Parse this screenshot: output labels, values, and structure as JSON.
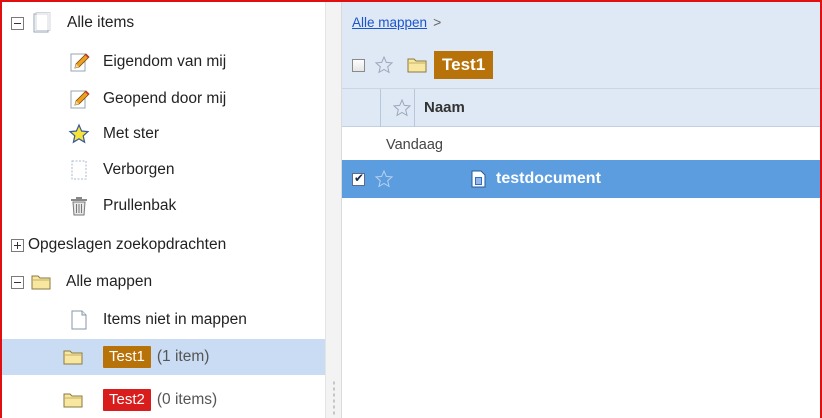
{
  "sidebar": {
    "all_items": {
      "label": "Alle items",
      "icon": "document-stack-icon"
    },
    "items": [
      {
        "label": "Eigendom van mij",
        "icon": "pencil-icon"
      },
      {
        "label": "Geopend door mij",
        "icon": "pencil-icon"
      },
      {
        "label": "Met ster",
        "icon": "star-icon"
      },
      {
        "label": "Verborgen",
        "icon": "hidden-document-icon"
      },
      {
        "label": "Prullenbak",
        "icon": "trash-icon"
      }
    ],
    "saved_searches": {
      "label": "Opgeslagen zoekopdrachten"
    },
    "all_folders": {
      "label": "Alle mappen",
      "icon": "folder-icon"
    },
    "not_in_folders": {
      "label": "Items niet in mappen",
      "icon": "document-icon"
    },
    "folders": [
      {
        "name": "Test1",
        "count": "(1 item)",
        "color": "#b8720a",
        "selected": true
      },
      {
        "name": "Test2",
        "count": "(0 items)",
        "color": "#d91c1c",
        "selected": false
      }
    ]
  },
  "main": {
    "breadcrumb": {
      "link": "Alle mappen",
      "separator": ">"
    },
    "folder_title": "Test1",
    "column_name": "Naam",
    "group_label": "Vandaag",
    "documents": [
      {
        "name": "testdocument",
        "checked": true
      }
    ]
  },
  "colors": {
    "accent_border": "#e01010",
    "header_bg": "#dfe9f5",
    "selected_row": "#5c9de0",
    "sidebar_selected": "#c9dcf4"
  }
}
